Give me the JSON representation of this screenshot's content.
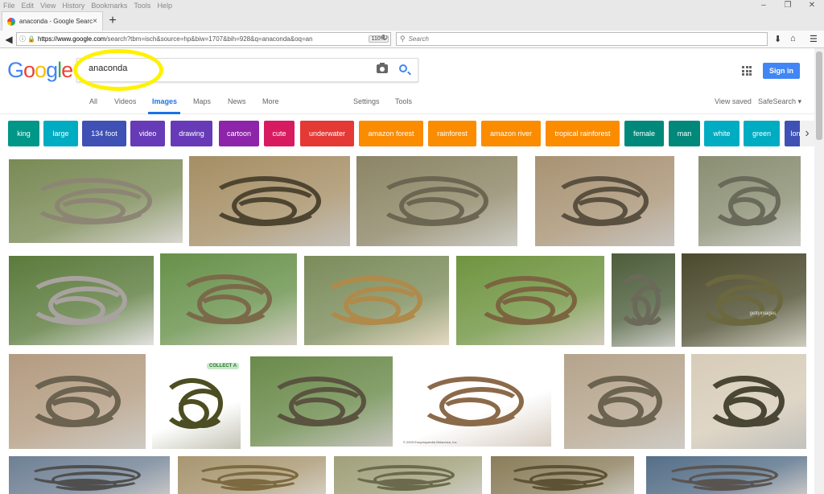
{
  "browser": {
    "menu": [
      "File",
      "Edit",
      "View",
      "History",
      "Bookmarks",
      "Tools",
      "Help"
    ],
    "tab_title": "anaconda - Google Search",
    "url_domain": "https://www.google.com",
    "url_path": "/search?tbm=isch&source=hp&biw=1707&bih=928&q=anaconda&oq=an",
    "zoom": "110%",
    "search_placeholder": "Search"
  },
  "google": {
    "logo": "Google",
    "query": "anaconda",
    "sign_in": "Sign in",
    "tabs": [
      "All",
      "Videos",
      "Images",
      "Maps",
      "News",
      "More"
    ],
    "settings": "Settings",
    "tools": "Tools",
    "view_saved": "View saved",
    "safesearch": "SafeSearch"
  },
  "chips": [
    {
      "label": "king",
      "color": "#009688"
    },
    {
      "label": "large",
      "color": "#00acc1"
    },
    {
      "label": "134 foot",
      "color": "#3f51b5"
    },
    {
      "label": "video",
      "color": "#673ab7"
    },
    {
      "label": "drawing",
      "color": "#673ab7"
    },
    {
      "label": "cartoon",
      "color": "#8e24aa"
    },
    {
      "label": "cute",
      "color": "#d81b60"
    },
    {
      "label": "underwater",
      "color": "#e53935"
    },
    {
      "label": "amazon forest",
      "color": "#fb8c00"
    },
    {
      "label": "rainforest",
      "color": "#fb8c00"
    },
    {
      "label": "amazon river",
      "color": "#fb8c00"
    },
    {
      "label": "tropical rainforest",
      "color": "#fb8c00"
    },
    {
      "label": "female",
      "color": "#00897b"
    },
    {
      "label": "man",
      "color": "#00897b"
    },
    {
      "label": "white",
      "color": "#00acc1"
    },
    {
      "label": "green",
      "color": "#00acc1"
    },
    {
      "label": "long",
      "color": "#3f51b5"
    }
  ],
  "image_overlays": {
    "watermark": "gettyimages",
    "collection_badge": "COLLECT A",
    "caption": "© 2009 Encyclopaedia Britannica, Inc."
  }
}
